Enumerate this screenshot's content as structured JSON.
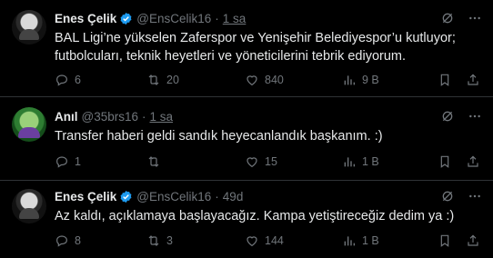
{
  "colors": {
    "background": "#000000",
    "text": "#e7e9ea",
    "muted": "#71767b",
    "verified": "#1d9bf0",
    "divider": "#2f3336"
  },
  "tweets": [
    {
      "name": "Enes Çelik",
      "verified": true,
      "handle": "@EnsCelik16",
      "separator": "·",
      "time": "1 sa",
      "text": "BAL Ligi’ne yükselen Zaferspor ve Yenişehir Belediyespor’u kutluyor; futbolcuları, teknik heyetleri ve yöneticilerini tebrik ediyorum.",
      "replies": "6",
      "retweets": "20",
      "likes": "840",
      "views": "9 B"
    },
    {
      "name": "Anıl",
      "verified": false,
      "handle": "@35brs16",
      "separator": "·",
      "time": "1 sa",
      "text": "Transfer haberi geldi sandık heyecanlandık başkanım. :)",
      "replies": "1",
      "retweets": "",
      "likes": "15",
      "views": "1 B"
    },
    {
      "name": "Enes Çelik",
      "verified": true,
      "handle": "@EnsCelik16",
      "separator": "·",
      "time": "49d",
      "text": "Az kaldı, açıklamaya başlayacağız. Kampa yetiştireceğiz dedim ya :)",
      "replies": "8",
      "retweets": "3",
      "likes": "144",
      "views": "1 B"
    }
  ],
  "icons": {
    "verified": "verified-badge-icon",
    "grok": "grok-icon",
    "more": "more-icon",
    "reply": "reply-icon",
    "retweet": "retweet-icon",
    "like": "like-icon",
    "views": "views-icon",
    "bookmark": "bookmark-icon",
    "share": "share-icon"
  }
}
